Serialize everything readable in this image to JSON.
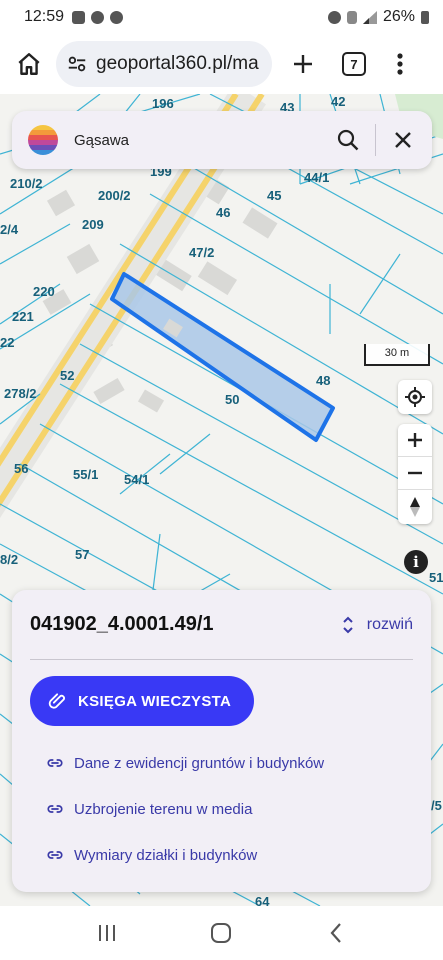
{
  "status_bar": {
    "time": "12:59",
    "battery": "26%"
  },
  "browser": {
    "url": "geoportal360.pl/ma",
    "tab_count": "7"
  },
  "search": {
    "value": "Gąsawa"
  },
  "map": {
    "labels": [
      "196",
      "42",
      "43",
      "199",
      "44/1",
      "210/2",
      "200/2",
      "45",
      "2/4",
      "209",
      "46",
      "47/2",
      "220",
      "221",
      "22",
      "52",
      "278/2",
      "48",
      "50",
      "56",
      "55/1",
      "54/1",
      "8/2",
      "57",
      "51",
      "/5",
      "64"
    ],
    "scale": "30 m",
    "highlight_color": "#1e73e8"
  },
  "panel": {
    "parcel_id": "041902_4.0001.49/1",
    "expand_label": "rozwiń",
    "primary_button": "KSIĘGA WIECZYSTA",
    "links": [
      "Dane z ewidencji gruntów i budynków",
      "Uzbrojenie terenu w media",
      "Wymiary działki i budynków"
    ]
  },
  "colors": {
    "accent": "#3939f5",
    "link": "#3a3aa8",
    "parcel_lines": "#3fb4d4",
    "road": "#f5d36b"
  }
}
